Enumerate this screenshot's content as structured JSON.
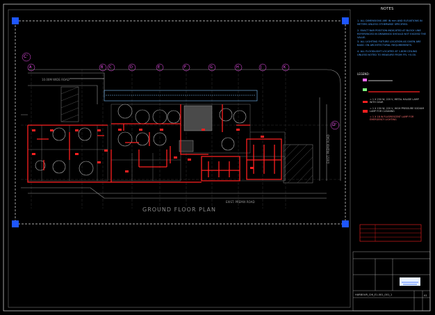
{
  "colors": {
    "background": "#000000",
    "linework": "#bdbdbd",
    "walls": "#ff2020",
    "grips": "#1e56ff",
    "notes": "#4fa3ff"
  },
  "notes": {
    "title": "NOTES",
    "items": [
      "1. ALL DIMENSIONS ARE IN mm AND ELEVATIONS IN METERS UNLESS OTHERWISE SPECIFIED.",
      "2. EXACT BAR POSITION INDICATED AT BLOCK LINE REFERENCED IN DRAWINGS SHOULD NOT EXCEED THE VALUE.",
      "3. ALL LIGHTING FIXTURE LOCATION AS GIVEN ARE BASIC ON ARCHITECTURAL REQUIREMENTS.",
      "4. ALL FLOODLIGHT LOCATED AT 1.80M CEILING UNLESS NOTED TO MEASURE FROM FFL +0.00."
    ]
  },
  "legend": {
    "title": "LEGEND:",
    "items": [
      "= 1 X 250 W, 220 V, METAL HALIDE LAMP WITH GEAR",
      "= 1 X 150 W, 220 V, HIGH PRESSURE SODIUM LAMP FOR CLEANING",
      "= 1 X 18 W FLUORESCENT LAMP FOR EMERGENCY LIGHTING"
    ]
  },
  "plan": {
    "title": "GROUND FLOOR PLAN",
    "road_top": "10.00M WIDE ROAD",
    "road_bottom": "EXIST. PREMIX ROAD",
    "road_right": "EXIST. PREMIX ROAD",
    "grid_top": [
      "A",
      "B",
      "C",
      "D",
      "E",
      "F",
      "G",
      "H",
      "J",
      "K"
    ],
    "grid_left": "C'",
    "grid_right": "D'"
  },
  "title_block": {
    "drawing_no": "HARBOUR_CHI_E1-001_001_1",
    "sheet": "A1"
  }
}
